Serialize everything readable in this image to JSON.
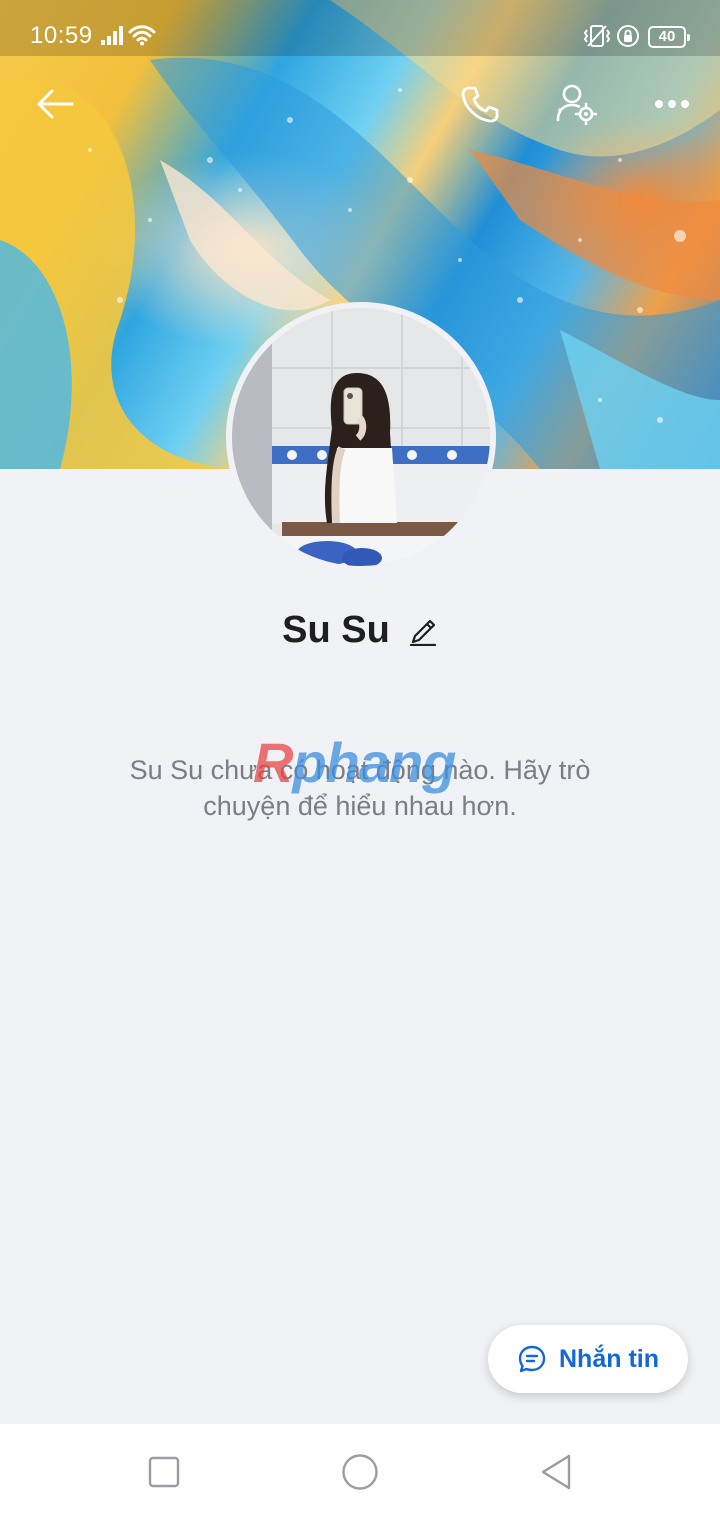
{
  "status_bar": {
    "time": "10:59",
    "battery": "40",
    "icons": [
      "signal-icon",
      "wifi-icon",
      "vibrate-icon",
      "rotation-lock-icon",
      "battery-icon"
    ]
  },
  "header": {
    "icons": [
      "back-arrow-icon",
      "phone-icon",
      "user-settings-icon",
      "more-icon"
    ]
  },
  "profile": {
    "name": "Su Su",
    "edit_icon": "pencil-icon"
  },
  "empty_state": {
    "message": "Su Su chưa có hoạt động nào. Hãy trò chuyện để hiểu nhau hơn."
  },
  "watermark": {
    "part1": "R",
    "part2": "phang"
  },
  "actions": {
    "message_button_label": "Nhắn tin",
    "message_icon": "chat-bubble-icon"
  },
  "nav_bar": {
    "icons": [
      "recent-apps-icon",
      "home-icon",
      "back-icon"
    ]
  },
  "colors": {
    "accent": "#1467d8",
    "background": "#f0f2f5",
    "text_secondary": "#7b7e85"
  }
}
